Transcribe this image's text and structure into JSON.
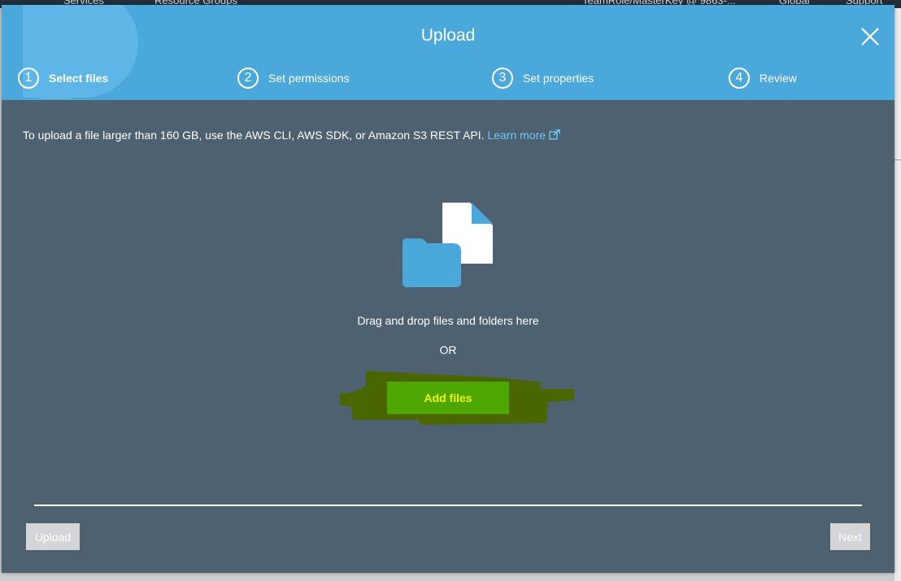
{
  "background": {
    "nav_items": [
      "Services",
      "Resource Groups",
      "TeamRole/MasterKey @ 9863-...",
      "Global",
      "Support"
    ]
  },
  "modal": {
    "title": "Upload",
    "close_icon": "close-icon",
    "steps": [
      {
        "number": "1",
        "label": "Select files",
        "active": true
      },
      {
        "number": "2",
        "label": "Set permissions",
        "active": false
      },
      {
        "number": "3",
        "label": "Set properties",
        "active": false
      },
      {
        "number": "4",
        "label": "Review",
        "active": false
      }
    ],
    "info_text": "To upload a file larger than 160 GB, use the AWS CLI, AWS SDK, or Amazon S3 REST API.",
    "learn_more": "Learn more",
    "drop_text": "Drag and drop files and folders here",
    "or_text": "OR",
    "add_files_label": "Add files",
    "upload_button": "Upload",
    "next_button": "Next"
  },
  "colors": {
    "header": "#4ba8da",
    "body": "#4d6170",
    "add_files_bg": "#4ea600",
    "add_files_text": "#f3f300",
    "highlight_scribble": "#4a6600",
    "link": "#6bc8f5"
  }
}
